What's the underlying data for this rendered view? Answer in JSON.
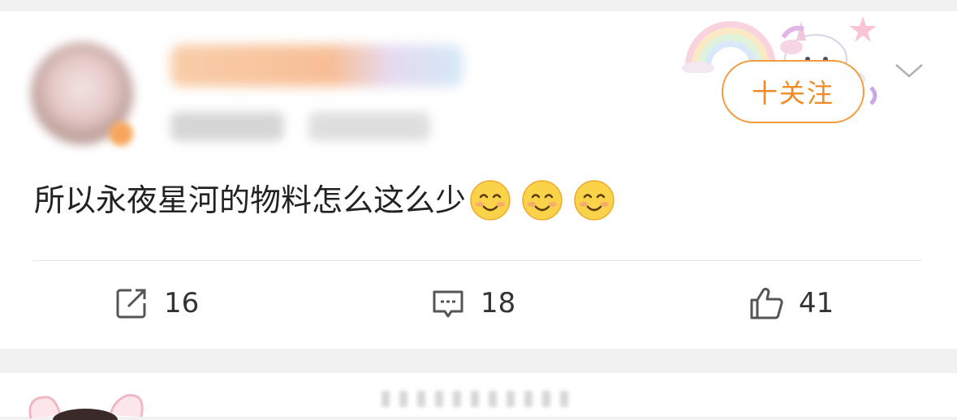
{
  "post": {
    "follow_label": "十关注",
    "text": "所以永夜星河的物料怎么这么少",
    "emojis": [
      "smile-blush-emoji",
      "smile-blush-emoji",
      "smile-blush-emoji"
    ]
  },
  "actions": {
    "repost_count": "16",
    "comment_count": "18",
    "like_count": "41"
  },
  "colors": {
    "accent": "#f08a26",
    "text": "#222222",
    "icon": "#555555"
  }
}
